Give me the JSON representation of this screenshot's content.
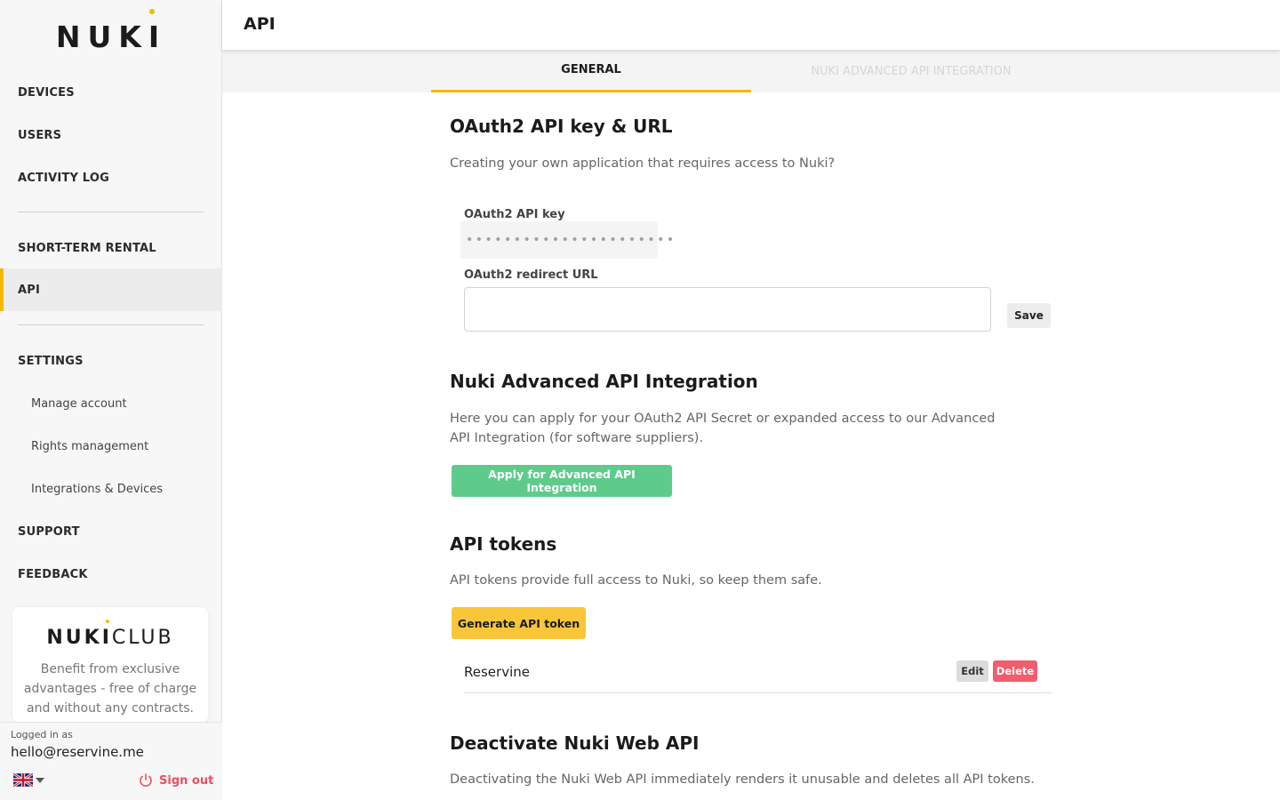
{
  "app": {
    "logo_text": "NUKI"
  },
  "sidebar": {
    "items": [
      {
        "label": "DEVICES"
      },
      {
        "label": "USERS"
      },
      {
        "label": "ACTIVITY LOG"
      },
      {
        "label": "SHORT-TERM RENTAL"
      },
      {
        "label": "API"
      },
      {
        "label": "SETTINGS"
      },
      {
        "label": "SUPPORT"
      },
      {
        "label": "FEEDBACK"
      }
    ],
    "settings_sub": [
      {
        "label": "Manage account"
      },
      {
        "label": "Rights management"
      },
      {
        "label": "Integrations & Devices"
      }
    ],
    "club": {
      "logo_bold": "NUKI",
      "logo_light": "CLUB",
      "text": "Benefit from exclusive advantages - free of charge and without any contracts."
    },
    "footer": {
      "logged_in_label": "Logged in as",
      "email": "hello@reservine.me",
      "sign_out": "Sign out"
    }
  },
  "header": {
    "title": "API"
  },
  "tabs": [
    {
      "label": "GENERAL",
      "active": true
    },
    {
      "label": "NUKI ADVANCED API INTEGRATION",
      "active": false
    }
  ],
  "oauth": {
    "title": "OAuth2 API key & URL",
    "description": "Creating your own application that requires access to Nuki?",
    "key_label": "OAuth2 API key",
    "key_value": "••••••••••••••••••••••",
    "redirect_label": "OAuth2 redirect URL",
    "redirect_value": "",
    "save_label": "Save"
  },
  "advanced": {
    "title": "Nuki Advanced API Integration",
    "description": "Here you can apply for your OAuth2 API Secret or expanded access to our Advanced API Integration (for software suppliers).",
    "button_label": "Apply for Advanced API Integration"
  },
  "tokens": {
    "title": "API tokens",
    "description": "API tokens provide full access to Nuki, so keep them safe.",
    "generate_label": "Generate API token",
    "items": [
      {
        "name": "Reservine",
        "edit_label": "Edit",
        "delete_label": "Delete"
      }
    ]
  },
  "deactivate": {
    "title": "Deactivate Nuki Web API",
    "description": "Deactivating the Nuki Web API immediately renders it unusable and deletes all API tokens."
  },
  "colors": {
    "accent": "#f5b800",
    "success": "#5fcb8b",
    "danger": "#f25d6d"
  }
}
